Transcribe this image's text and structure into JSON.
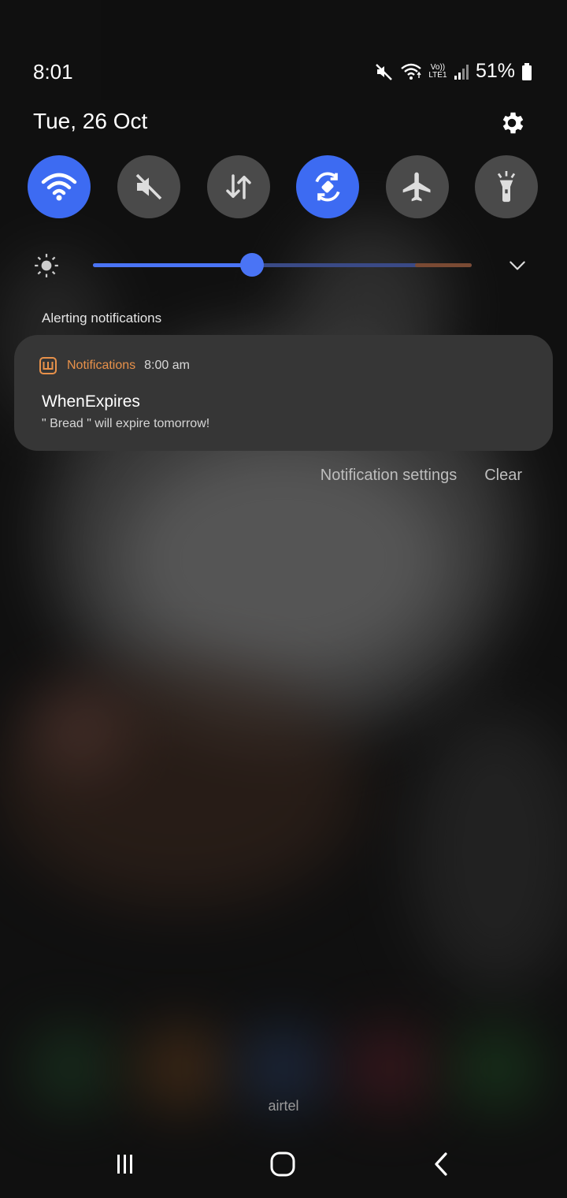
{
  "status_bar": {
    "time": "8:01",
    "network_label": "Vo)) LTE1",
    "battery_percent": "51%",
    "battery_level": 0.51
  },
  "header": {
    "date": "Tue, 26 Oct"
  },
  "quick_settings": [
    {
      "name": "wifi",
      "icon": "wifi-icon",
      "active": true
    },
    {
      "name": "sound",
      "icon": "mute-icon",
      "active": false
    },
    {
      "name": "mobile-data",
      "icon": "data-arrows-icon",
      "active": false
    },
    {
      "name": "auto-rotate",
      "icon": "auto-rotate-icon",
      "active": true
    },
    {
      "name": "airplane-mode",
      "icon": "airplane-icon",
      "active": false
    },
    {
      "name": "flashlight",
      "icon": "flashlight-icon",
      "active": false
    }
  ],
  "brightness": {
    "level": 0.42
  },
  "notifications": {
    "section_label": "Alerting notifications",
    "items": [
      {
        "app_name": "Notifications",
        "time": "8:00 am",
        "title": "WhenExpires",
        "body": "\" Bread \" will expire tomorrow!"
      }
    ],
    "settings_label": "Notification settings",
    "clear_label": "Clear"
  },
  "carrier": "airtel",
  "colors": {
    "accent_active": "#3d6bf2",
    "tile_inactive": "#4a4a4a",
    "app_name": "#e8914a",
    "card_bg": "#363636"
  }
}
